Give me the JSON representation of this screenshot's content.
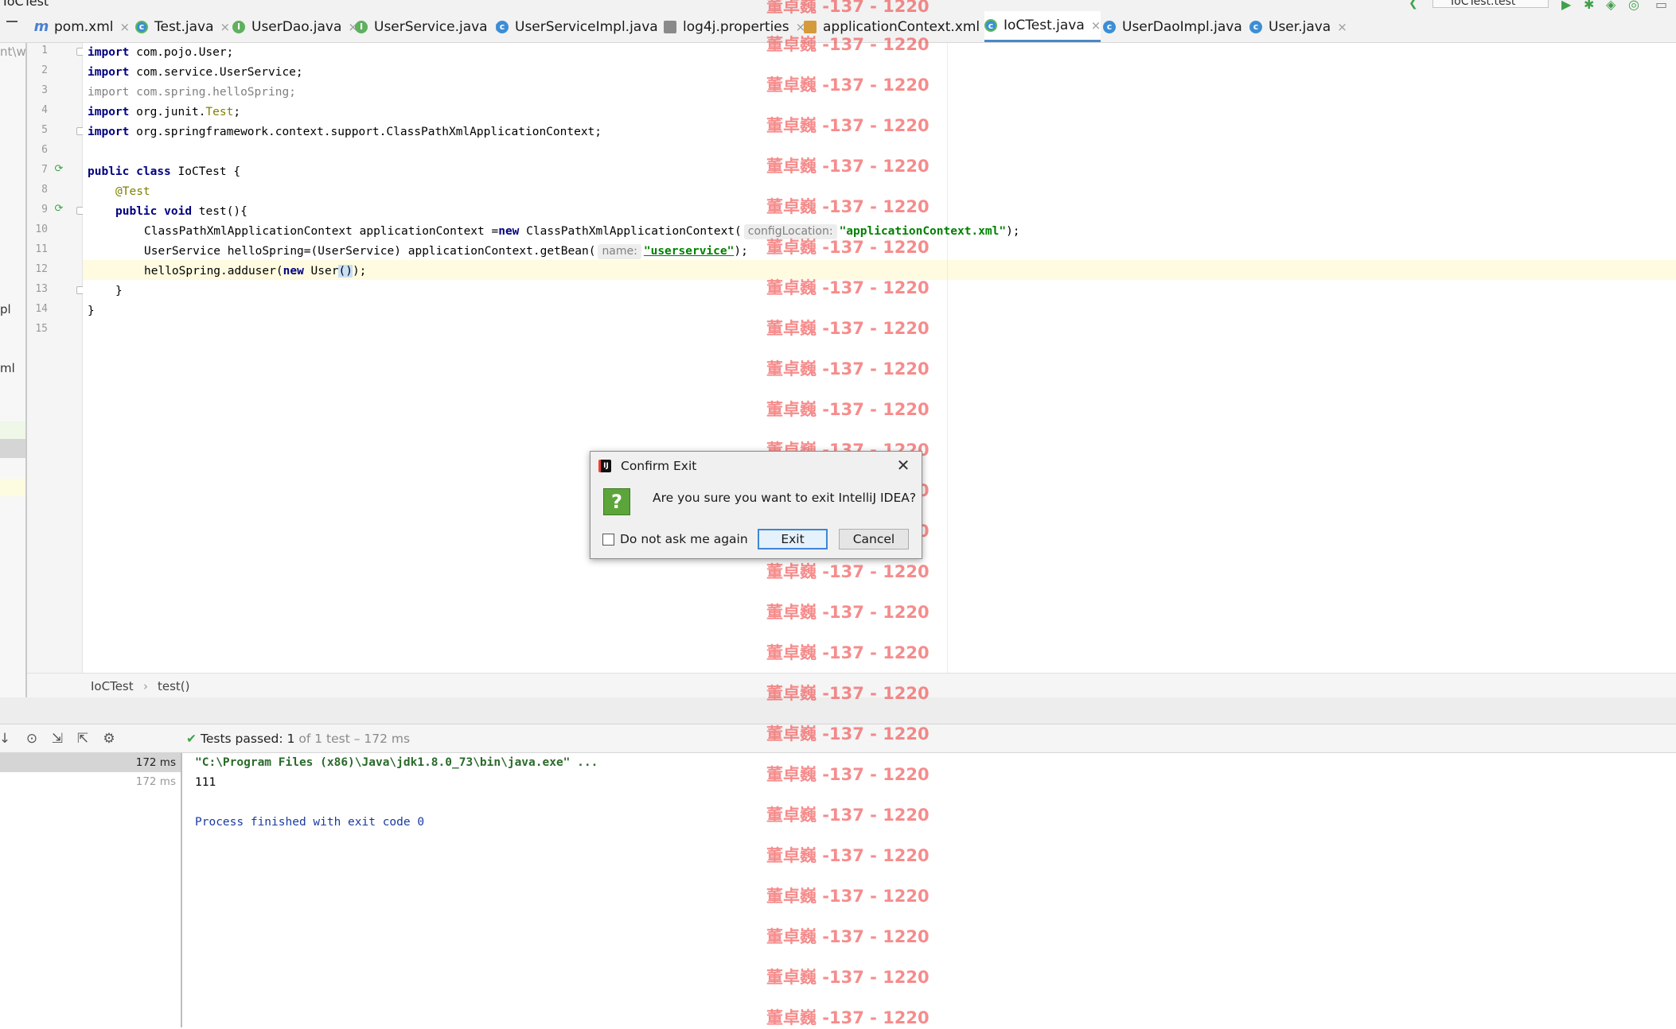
{
  "window": {
    "title": "IoCTest",
    "run_config": "IoCTest.test"
  },
  "tabs": [
    {
      "label": "pom.xml",
      "icon": "maven-icon"
    },
    {
      "label": "Test.java",
      "icon": "class-icon"
    },
    {
      "label": "UserDao.java",
      "icon": "interface-icon"
    },
    {
      "label": "UserService.java",
      "icon": "interface-icon"
    },
    {
      "label": "UserServiceImpl.java",
      "icon": "class-icon"
    },
    {
      "label": "log4j.properties",
      "icon": "properties-icon"
    },
    {
      "label": "applicationContext.xml",
      "icon": "xml-icon"
    },
    {
      "label": "IoCTest.java",
      "icon": "class-icon",
      "active": true
    },
    {
      "label": "UserDaoImpl.java",
      "icon": "class-icon"
    },
    {
      "label": "User.java",
      "icon": "class-icon"
    }
  ],
  "left_strip_fragments": [
    "nt\\wo",
    "pl",
    "ml"
  ],
  "editor": {
    "line_numbers": [
      "1",
      "2",
      "3",
      "4",
      "5",
      "6",
      "7",
      "8",
      "9",
      "10",
      "11",
      "12",
      "13",
      "14",
      "15"
    ],
    "code": {
      "l1_kw": "import",
      "l1_rest": " com.pojo.User;",
      "l2_kw": "import",
      "l2_rest": " com.service.UserService;",
      "l3_kw": "import",
      "l3_rest": " com.spring.helloSpring;",
      "l4_kw": "import",
      "l4_rest": " org.junit.",
      "l4_ann": "Test",
      "l4_end": ";",
      "l5_kw": "import",
      "l5_rest": " org.springframework.context.support.ClassPathXmlApplicationContext;",
      "l7_kw1": "public",
      "l7_kw2": "class",
      "l7_rest": " IoCTest {",
      "l8_ann": "@Test",
      "l9_kw1": "public",
      "l9_kw2": "void",
      "l9_rest": " test(){",
      "l10_a": "ClassPathXmlApplicationContext applicationContext =",
      "l10_kw": "new",
      "l10_b": " ClassPathXmlApplicationContext(",
      "l10_hint": "configLocation:",
      "l10_str": "\"applicationContext.xml\"",
      "l10_end": ");",
      "l11_a": "UserService helloSpring=(UserService) applicationContext.getBean(",
      "l11_hint": "name:",
      "l11_str": "\"userservice\"",
      "l11_end": ");",
      "l12_a": "helloSpring.adduser(",
      "l12_kw": "new",
      "l12_b": " User",
      "l12_paren": "()",
      "l12_end": ");",
      "l13": "}",
      "l14": "}"
    }
  },
  "breadcrumb": [
    "IoCTest",
    "test()"
  ],
  "run_panel": {
    "status_label": "Tests passed:",
    "status_count": "1",
    "status_rest": "of 1 test – 172 ms",
    "tree_times": [
      "172 ms",
      "172 ms"
    ],
    "console": [
      "\"C:\\Program Files (x86)\\Java\\jdk1.8.0_73\\bin\\java.exe\" ...",
      "111",
      "Process finished with exit code 0"
    ]
  },
  "dialog": {
    "title": "Confirm Exit",
    "message": "Are you sure you want to exit IntelliJ IDEA?",
    "checkbox_label": "Do not ask me again",
    "exit_label": "Exit",
    "cancel_label": "Cancel"
  },
  "watermark": "董卓巍 -137 - 1220",
  "colors": {
    "keyword": "#000080",
    "annotation": "#808000",
    "string": "#008000",
    "active_tab_underline": "#4a88c7",
    "current_line": "#fffbe0",
    "watermark": "#f04646"
  }
}
